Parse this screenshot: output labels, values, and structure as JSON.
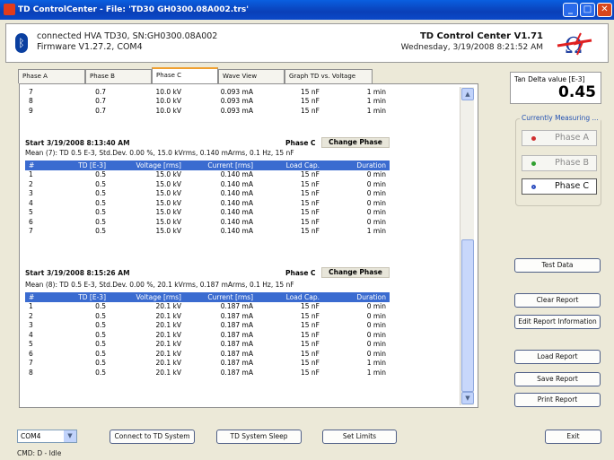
{
  "window": {
    "title": "TD ControlCenter - File: 'TD30 GH0300.08A002.trs'",
    "minimize": "_",
    "maximize": "□",
    "close": "✕"
  },
  "header": {
    "connection": "connected HVA TD30, SN:GH0300.08A002",
    "firmware": "Firmware V1.27.2, COM4",
    "app_title": "TD Control Center V1.71",
    "datetime": "Wednesday, 3/19/2008 8:21:52 AM"
  },
  "tabs": [
    "Phase A",
    "Phase B",
    "Phase C",
    "Wave View",
    "Graph TD vs. Voltage"
  ],
  "active_tab": "Phase C",
  "top_rows": [
    [
      "7",
      "0.7",
      "10.0 kV",
      "0.093 mA",
      "15 nF",
      "1 min"
    ],
    [
      "8",
      "0.7",
      "10.0 kV",
      "0.093 mA",
      "15 nF",
      "1 min"
    ],
    [
      "9",
      "0.7",
      "10.0 kV",
      "0.093 mA",
      "15 nF",
      "1 min"
    ]
  ],
  "sections": [
    {
      "start": "Start 3/19/2008 8:13:40 AM",
      "phase": "Phase C",
      "change": "Change Phase",
      "mean": "Mean (7): TD 0.5 E-3, Std.Dev. 0.00 %, 15.0 kVrms, 0.140 mArms, 0.1 Hz, 15 nF",
      "columns": [
        "#",
        "TD [E-3]",
        "Voltage [rms]",
        "Current [rms]",
        "Load Cap.",
        "Duration"
      ],
      "rows": [
        [
          "1",
          "0.5",
          "15.0 kV",
          "0.140 mA",
          "15 nF",
          "0 min"
        ],
        [
          "2",
          "0.5",
          "15.0 kV",
          "0.140 mA",
          "15 nF",
          "0 min"
        ],
        [
          "3",
          "0.5",
          "15.0 kV",
          "0.140 mA",
          "15 nF",
          "0 min"
        ],
        [
          "4",
          "0.5",
          "15.0 kV",
          "0.140 mA",
          "15 nF",
          "0 min"
        ],
        [
          "5",
          "0.5",
          "15.0 kV",
          "0.140 mA",
          "15 nF",
          "0 min"
        ],
        [
          "6",
          "0.5",
          "15.0 kV",
          "0.140 mA",
          "15 nF",
          "0 min"
        ],
        [
          "7",
          "0.5",
          "15.0 kV",
          "0.140 mA",
          "15 nF",
          "1 min"
        ]
      ]
    },
    {
      "start": "Start 3/19/2008 8:15:26 AM",
      "phase": "Phase C",
      "change": "Change Phase",
      "mean": "Mean (8): TD 0.5 E-3, Std.Dev. 0.00 %, 20.1 kVrms, 0.187 mArms, 0.1 Hz, 15 nF",
      "columns": [
        "#",
        "TD [E-3]",
        "Voltage [rms]",
        "Current [rms]",
        "Load Cap.",
        "Duration"
      ],
      "rows": [
        [
          "1",
          "0.5",
          "20.1 kV",
          "0.187 mA",
          "15 nF",
          "0 min"
        ],
        [
          "2",
          "0.5",
          "20.1 kV",
          "0.187 mA",
          "15 nF",
          "0 min"
        ],
        [
          "3",
          "0.5",
          "20.1 kV",
          "0.187 mA",
          "15 nF",
          "0 min"
        ],
        [
          "4",
          "0.5",
          "20.1 kV",
          "0.187 mA",
          "15 nF",
          "0 min"
        ],
        [
          "5",
          "0.5",
          "20.1 kV",
          "0.187 mA",
          "15 nF",
          "0 min"
        ],
        [
          "6",
          "0.5",
          "20.1 kV",
          "0.187 mA",
          "15 nF",
          "0 min"
        ],
        [
          "7",
          "0.5",
          "20.1 kV",
          "0.187 mA",
          "15 nF",
          "1 min"
        ],
        [
          "8",
          "0.5",
          "20.1 kV",
          "0.187 mA",
          "15 nF",
          "1 min"
        ]
      ]
    }
  ],
  "tan_delta": {
    "label": "Tan Delta value [E-3]",
    "value": "0.45"
  },
  "measuring": {
    "title": "Currently Measuring ...",
    "phases": [
      {
        "label": "Phase A",
        "dot_color": "#d03030",
        "active": false
      },
      {
        "label": "Phase B",
        "dot_color": "#30a030",
        "active": false
      },
      {
        "label": "Phase C",
        "dot_color": "#3050c0",
        "active": true
      }
    ]
  },
  "buttons": {
    "test_data": "Test Data",
    "clear_report": "Clear Report",
    "edit_report": "Edit Report Information",
    "load_report": "Load Report",
    "save_report": "Save Report",
    "print_report": "Print Report",
    "connect": "Connect to TD System",
    "sleep": "TD System Sleep",
    "set_limits": "Set Limits",
    "exit": "Exit"
  },
  "port": {
    "value": "COM4"
  },
  "status": "CMD: D - Idle",
  "colors": {
    "title_bar": "#0a4fd8",
    "table_header": "#3a6bd0",
    "window_bg": "#ece9d8"
  }
}
